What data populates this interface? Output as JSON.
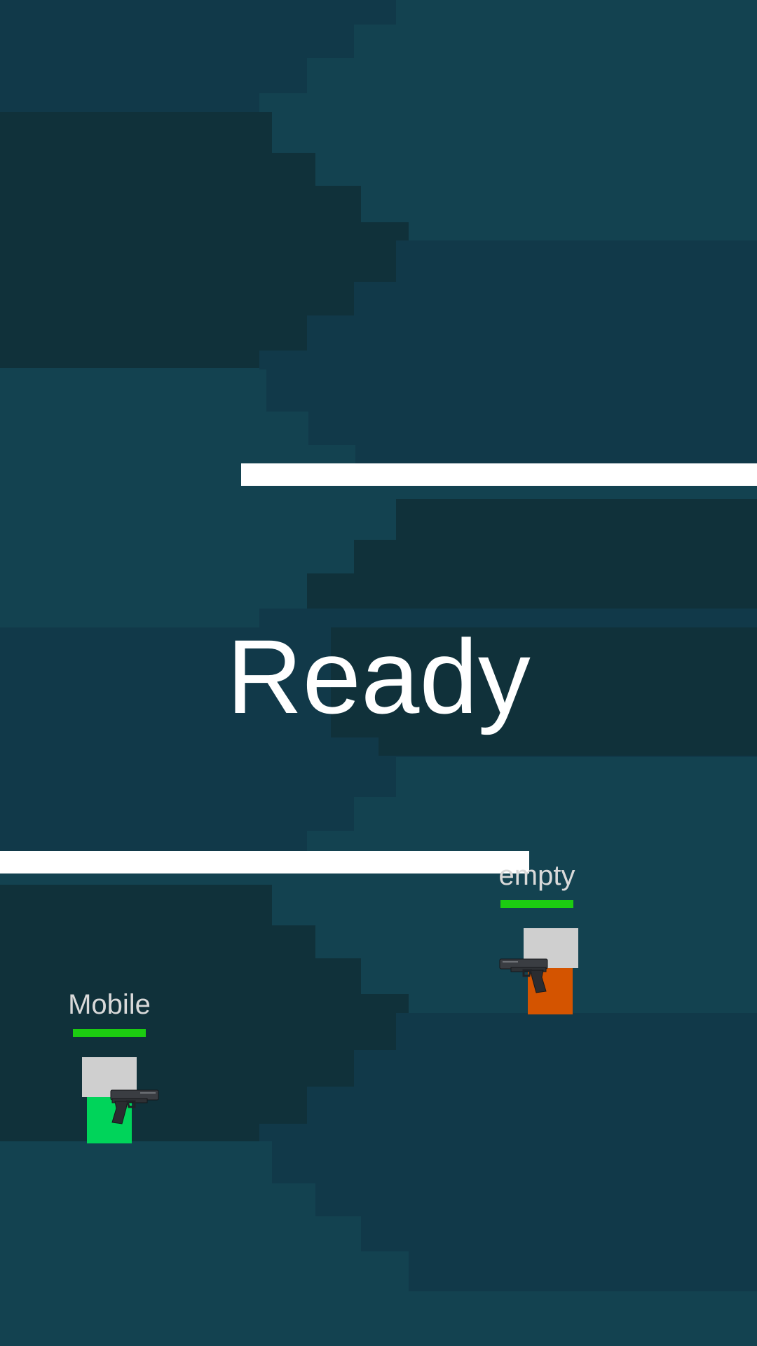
{
  "hud": {
    "status_text": "Ready"
  },
  "players": [
    {
      "name": "Mobile",
      "health": 1.0,
      "health_color": "#1ccc11",
      "body_color": "#00d45a",
      "facing": "right",
      "weapon": "pistol-icon"
    },
    {
      "name": "empty",
      "health": 1.0,
      "health_color": "#1ccc11",
      "body_color": "#d45400",
      "facing": "left",
      "weapon": "pistol-icon"
    }
  ],
  "colors": {
    "background_light": "#134250",
    "background_mid": "#113949",
    "background_dark": "#10313a",
    "platform": "#ffffff",
    "head": "#cfcfcf"
  }
}
